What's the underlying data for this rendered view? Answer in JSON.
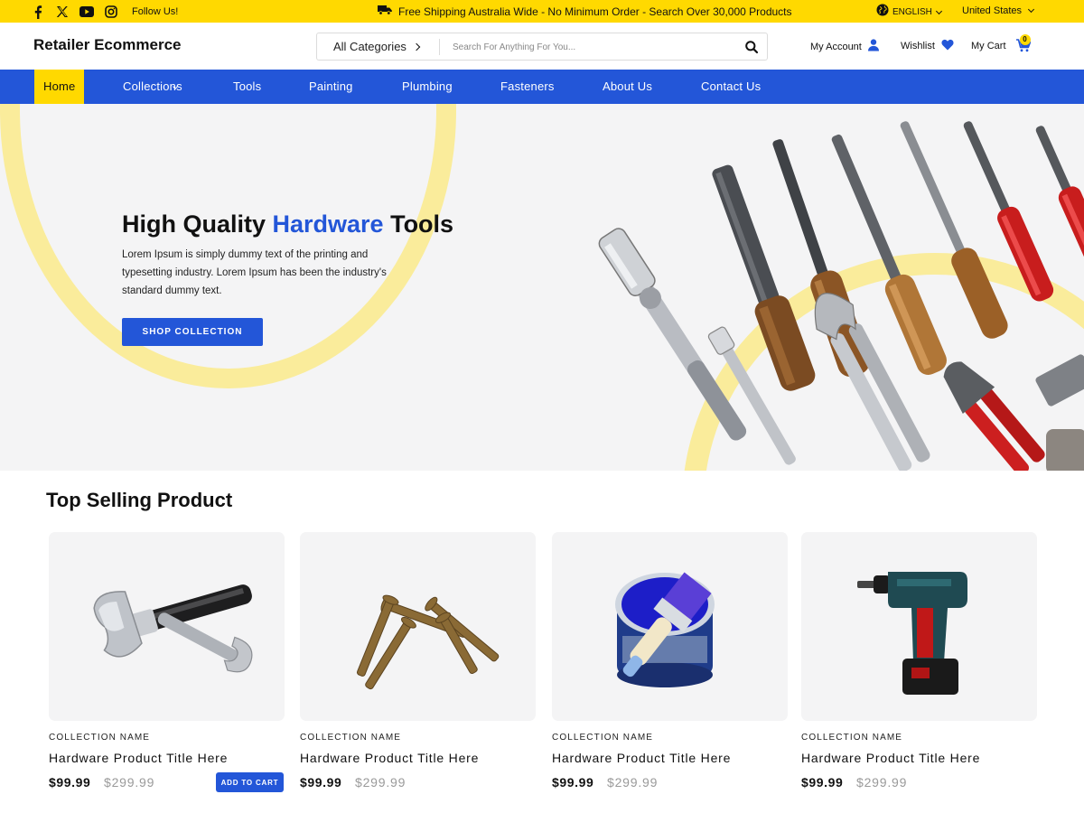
{
  "topbar": {
    "social_icons": [
      "facebook-icon",
      "x-icon",
      "youtube-icon",
      "instagram-icon"
    ],
    "follow_text": "Follow Us!",
    "promo_text": "Free Shipping Australia Wide - No Minimum Order - Search Over 30,000 Products",
    "language": "ENGLISH",
    "country": "United States",
    "background_color": "#ffd900"
  },
  "header": {
    "logo": "Retailer Ecommerce",
    "category_label": "All Categories",
    "search_placeholder": "Search For Anything For You...",
    "account_label": "My Account",
    "wishlist_label": "Wishlist",
    "cart_label": "My Cart",
    "cart_count": "0"
  },
  "nav": {
    "items": [
      {
        "label": "Home",
        "active": true
      },
      {
        "label": "Collections",
        "has_dropdown": true
      },
      {
        "label": "Tools"
      },
      {
        "label": "Painting"
      },
      {
        "label": "Plumbing"
      },
      {
        "label": "Fasteners"
      },
      {
        "label": "About Us"
      },
      {
        "label": "Contact Us"
      }
    ],
    "background_color": "#2356d8"
  },
  "hero": {
    "title_part1": "High Quality ",
    "title_highlight": "Hardware",
    "title_part2": " Tools",
    "description": "Lorem Ipsum is simply dummy text of the printing and typesetting industry. Lorem Ipsum has been the industry's standard dummy text.",
    "cta_label": "SHOP COLLECTION",
    "image": "hardware-tools-photo"
  },
  "products": {
    "section_title": "Top Selling Product",
    "add_to_cart_label": "ADD TO CART",
    "items": [
      {
        "image": "hammer-and-wrench-photo",
        "collection": "COLLECTION NAME",
        "title": "Hardware Product Title Here",
        "price": "$99.99",
        "old_price": "$299.99",
        "show_add_to_cart": true
      },
      {
        "image": "screws-photo",
        "collection": "COLLECTION NAME",
        "title": "Hardware Product Title Here",
        "price": "$99.99",
        "old_price": "$299.99"
      },
      {
        "image": "paint-can-and-brush-photo",
        "collection": "COLLECTION NAME",
        "title": "Hardware Product Title Here",
        "price": "$99.99",
        "old_price": "$299.99"
      },
      {
        "image": "cordless-drill-photo",
        "collection": "COLLECTION NAME",
        "title": "Hardware Product Title Here",
        "price": "$99.99",
        "old_price": "$299.99"
      }
    ]
  },
  "colors": {
    "accent_blue": "#2356d8",
    "accent_yellow": "#ffd900",
    "ring_yellow": "#faec9b",
    "panel_gray": "#f4f4f5",
    "old_price_gray": "#9a9a9a"
  }
}
